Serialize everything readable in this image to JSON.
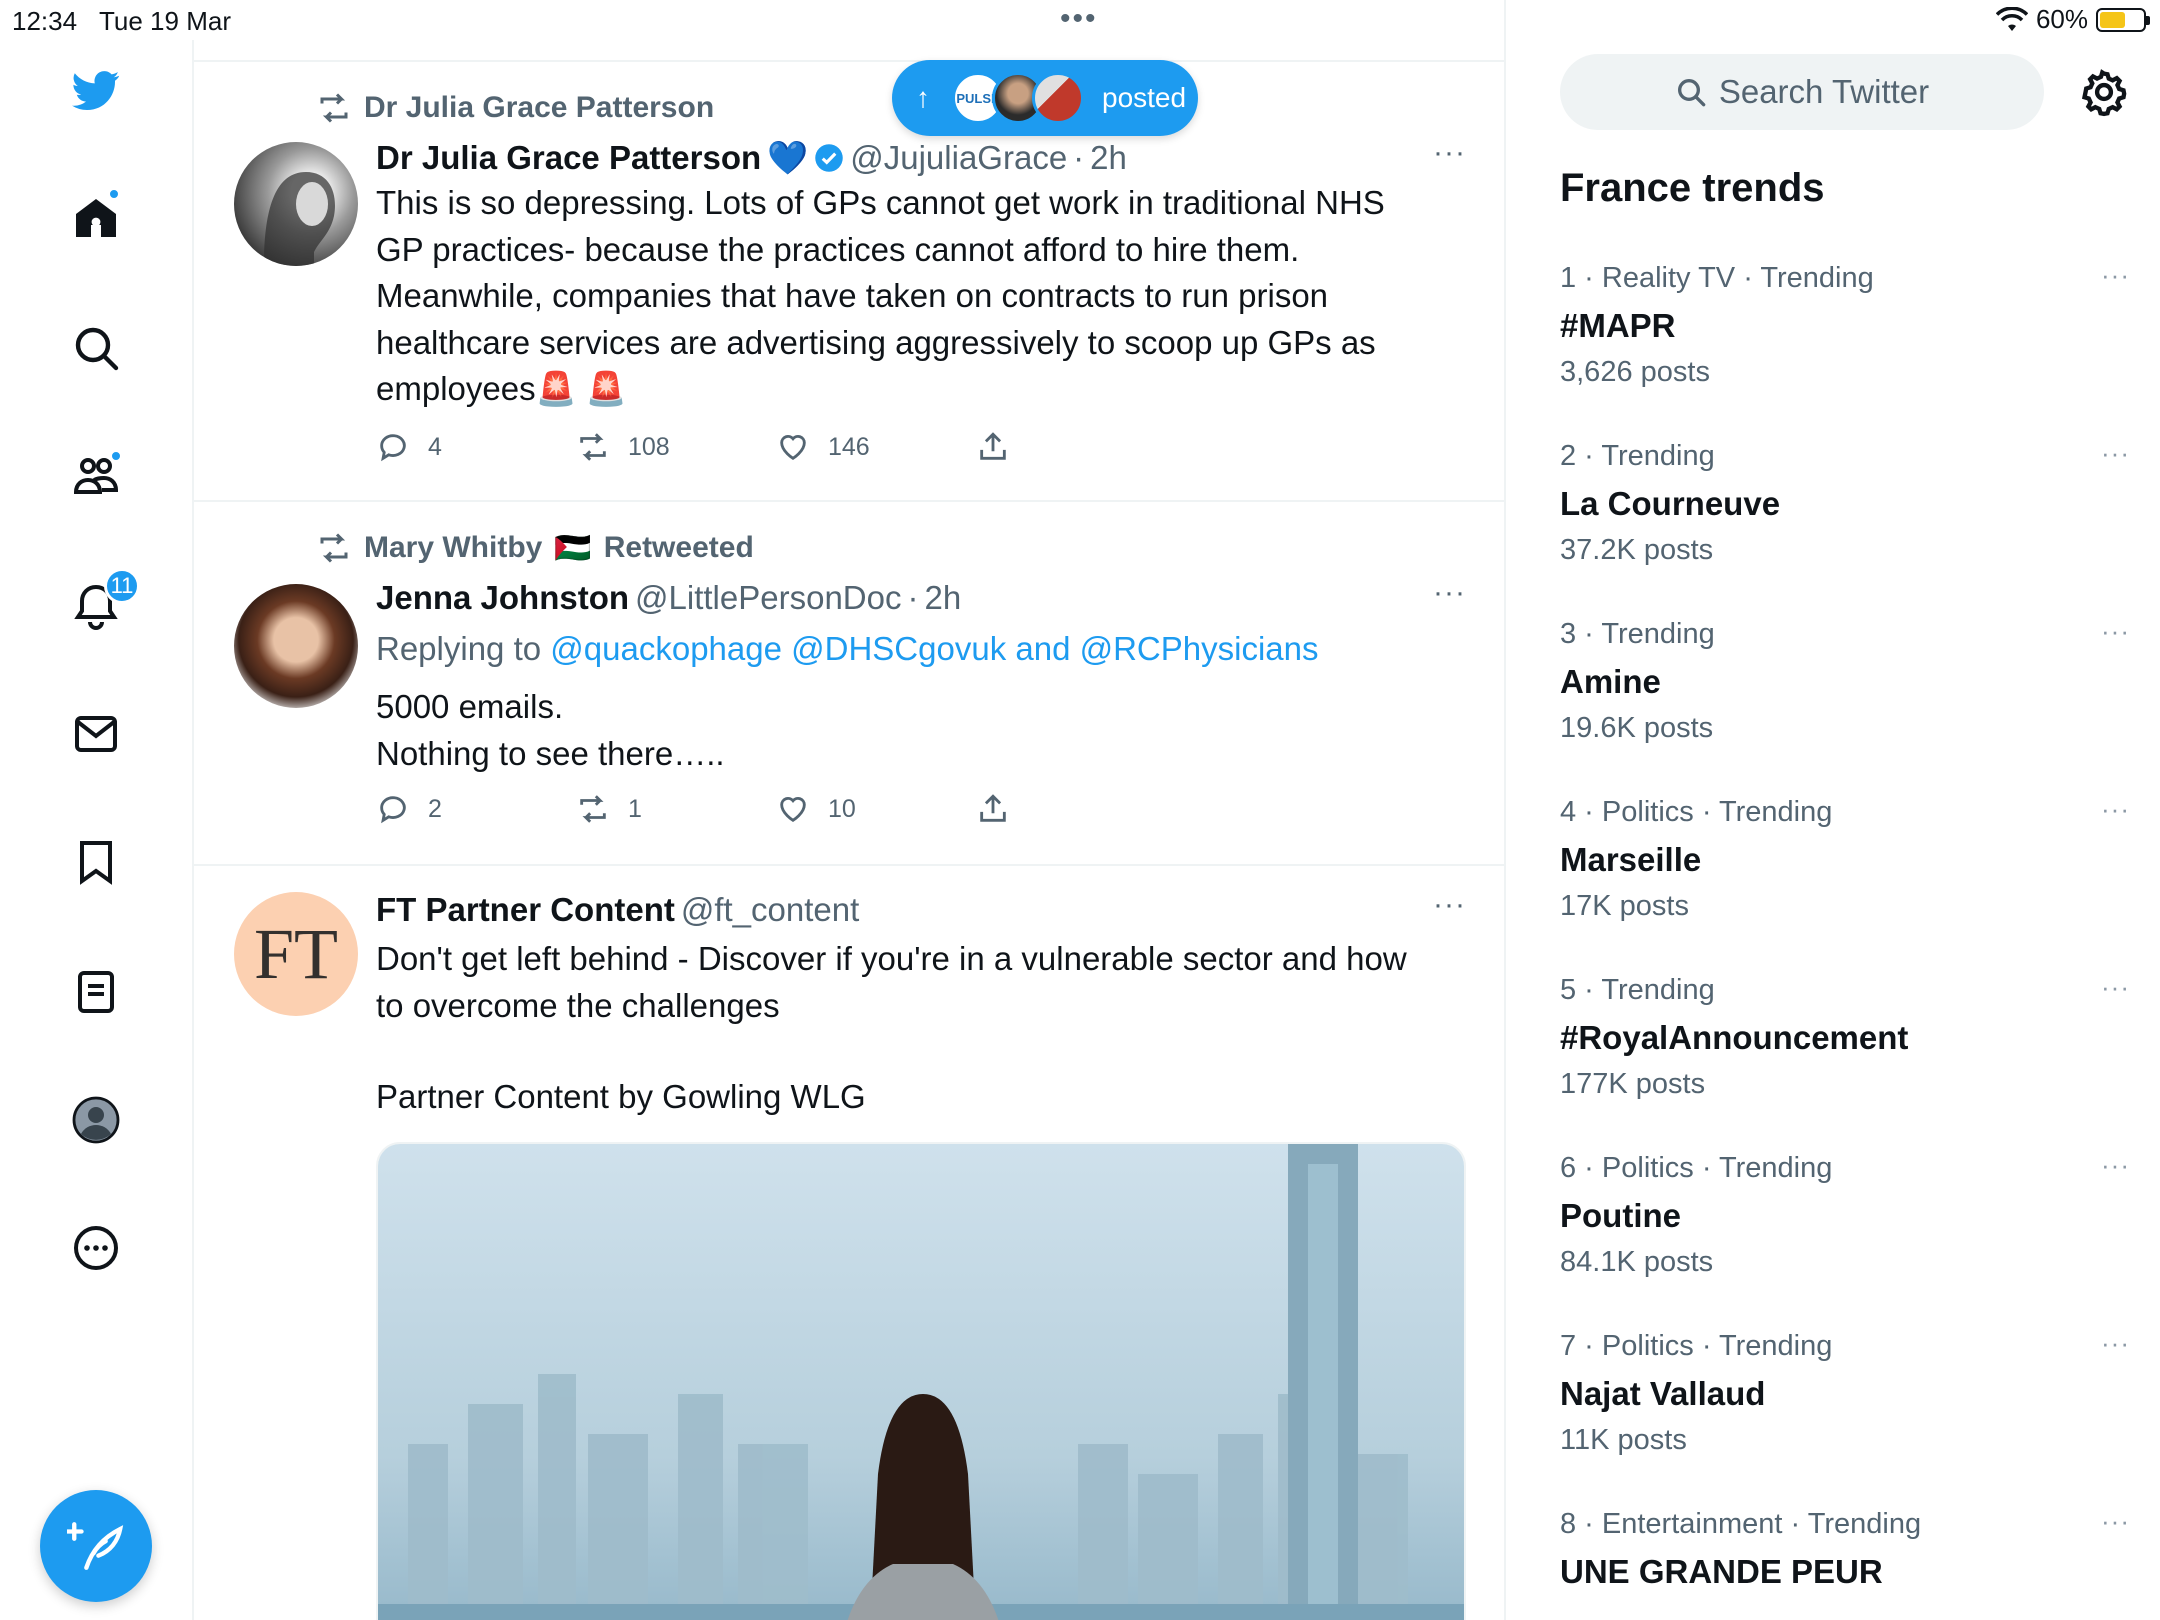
{
  "status": {
    "time": "12:34",
    "date": "Tue 19 Mar",
    "battery": "60%",
    "dots": "•••"
  },
  "nav": {
    "notifications_badge": "11",
    "items": [
      "home-icon",
      "search-icon",
      "communities-icon",
      "notifications-icon",
      "messages-icon",
      "bookmarks-icon",
      "lists-icon",
      "profile-icon",
      "more-icon"
    ]
  },
  "posted_pill": {
    "label": "posted",
    "arrow": "↑",
    "pulse_label": "PULSE"
  },
  "tweets": [
    {
      "social": "Dr Julia Grace Patterson",
      "name": "Dr Julia Grace Patterson",
      "emoji": "💙",
      "handle": "@JujuliaGrace",
      "sep": "·",
      "time": "2h",
      "text_lines": [
        "This is so depressing. Lots of GPs cannot get work in traditional NHS",
        "GP practices- because the practices cannot afford to hire them.",
        "Meanwhile, companies that have taken on contracts to run prison",
        "healthcare services are advertising aggressively to scoop up GPs as",
        "employees🚨 🚨"
      ],
      "replies": "4",
      "retweets": "108",
      "likes": "146"
    },
    {
      "social_name": "Mary Whitby",
      "social_flag": "🇵🇸",
      "social_suffix": "Retweeted",
      "name": "Jenna Johnston",
      "handle": "@LittlePersonDoc",
      "sep": "·",
      "time": "2h",
      "reply_prefix": "Replying to",
      "reply_targets": "@quackophage @DHSCgovuk and @RCPhysicians",
      "text_lines": [
        "5000 emails.",
        "Nothing to see there….."
      ],
      "replies": "2",
      "retweets": "1",
      "likes": "10"
    },
    {
      "avatar_text": "FT",
      "name": "FT Partner Content",
      "handle": "@ft_content",
      "text_lines": [
        "Don't get left behind - Discover if you're in a vulnerable sector and how",
        "to overcome the challenges"
      ],
      "partner_line": "Partner Content by Gowling WLG"
    }
  ],
  "right": {
    "search_placeholder": "Search Twitter",
    "trends_title": "France trends",
    "trends": [
      {
        "meta": "1 · Reality TV · Trending",
        "name": "#MAPR",
        "count": "3,626 posts"
      },
      {
        "meta": "2 · Trending",
        "name": "La Courneuve",
        "count": "37.2K posts"
      },
      {
        "meta": "3 · Trending",
        "name": "Amine",
        "count": "19.6K posts"
      },
      {
        "meta": "4 · Politics · Trending",
        "name": "Marseille",
        "count": "17K posts"
      },
      {
        "meta": "5 · Trending",
        "name": "#RoyalAnnouncement",
        "count": "177K posts"
      },
      {
        "meta": "6 · Politics · Trending",
        "name": "Poutine",
        "count": "84.1K posts"
      },
      {
        "meta": "7 · Politics · Trending",
        "name": "Najat Vallaud",
        "count": "11K posts"
      },
      {
        "meta": "8 · Entertainment · Trending",
        "name": "UNE GRANDE PEUR",
        "count": ""
      }
    ],
    "more": "···"
  },
  "colors": {
    "accent": "#1d9bf0",
    "text": "#0f1419",
    "muted": "#536471",
    "border": "#eff3f4"
  }
}
